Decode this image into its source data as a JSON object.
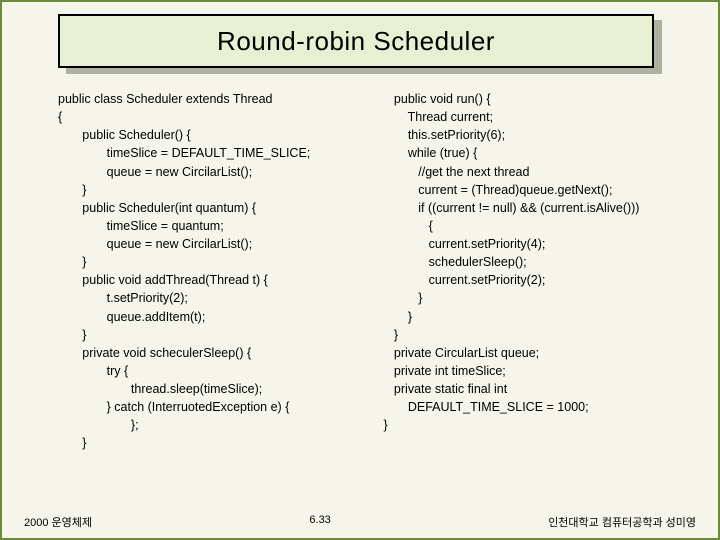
{
  "title": "Round-robin Scheduler",
  "code_left": "public class Scheduler extends Thread\n{\n       public Scheduler() {\n              timeSlice = DEFAULT_TIME_SLICE;\n              queue = new CircilarList();\n       }\n       public Scheduler(int quantum) {\n              timeSlice = quantum;\n              queue = new CircilarList();\n       }\n       public void addThread(Thread t) {\n              t.setPriority(2);\n              queue.addItem(t);\n       }\n       private void scheculerSleep() {\n              try {\n                     thread.sleep(timeSlice);\n              } catch (InterruotedException e) {\n                     };\n       }",
  "code_right": "   public void run() {\n       Thread current;\n       this.setPriority(6);\n       while (true) {\n          //get the next thread\n          current = (Thread)queue.getNext();\n          if ((current != null) && (current.isAlive()))\n             {\n             current.setPriority(4);\n             schedulerSleep();\n             current.setPriority(2);\n          }\n       }\n   }\n   private CircularList queue;\n   private int timeSlice;\n   private static final int\n       DEFAULT_TIME_SLICE = 1000;\n}",
  "footer": {
    "left": "2000 운영체제",
    "center": "6.33",
    "right": "인천대학교 컴퓨터공학과 성미영"
  }
}
